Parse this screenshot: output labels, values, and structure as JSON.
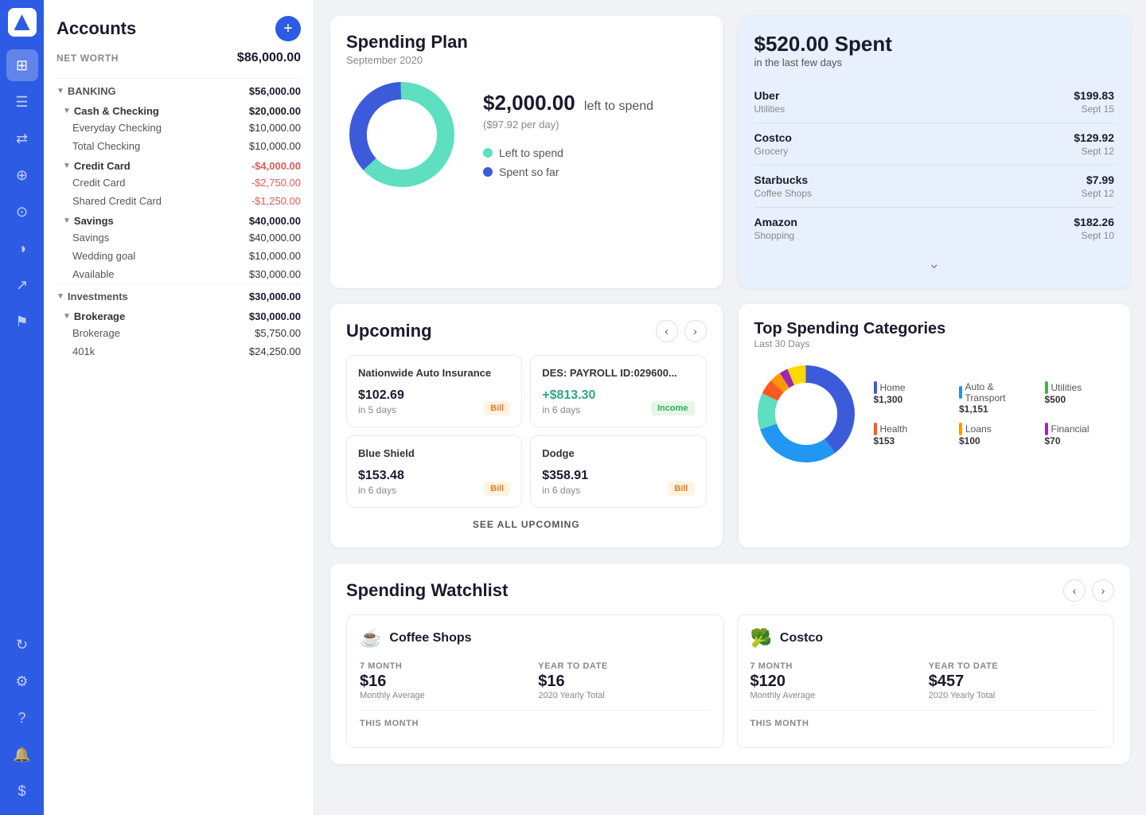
{
  "sidebar": {
    "nav_items": [
      {
        "id": "dashboard",
        "icon": "⊞",
        "active": true
      },
      {
        "id": "transactions",
        "icon": "≡"
      },
      {
        "id": "transfer",
        "icon": "⇄"
      },
      {
        "id": "upload",
        "icon": "⬆"
      },
      {
        "id": "search",
        "icon": "⊙"
      },
      {
        "id": "chart",
        "icon": "◑"
      },
      {
        "id": "trend",
        "icon": "↗"
      },
      {
        "id": "goal",
        "icon": "⚑"
      }
    ],
    "bottom_items": [
      {
        "id": "refresh",
        "icon": "↻"
      },
      {
        "id": "settings",
        "icon": "⚙"
      },
      {
        "id": "help",
        "icon": "?"
      },
      {
        "id": "notifications",
        "icon": "🔔"
      },
      {
        "id": "account",
        "icon": "$"
      }
    ]
  },
  "accounts": {
    "title": "Accounts",
    "add_button": "+",
    "net_worth_label": "NET WORTH",
    "net_worth_value": "$86,000.00",
    "sections": [
      {
        "id": "banking",
        "label": "BANKING",
        "value": "$56,000.00",
        "subsections": [
          {
            "id": "cash-checking",
            "label": "Cash & Checking",
            "value": "$20,000.00",
            "accounts": [
              {
                "name": "Everyday Checking",
                "value": "$10,000.00",
                "negative": false
              },
              {
                "name": "Total Checking",
                "value": "$10,000.00",
                "negative": false
              }
            ]
          },
          {
            "id": "credit-card",
            "label": "Credit Card",
            "value": "-$4,000.00",
            "accounts": [
              {
                "name": "Credit Card",
                "value": "-$2,750.00",
                "negative": true
              },
              {
                "name": "Shared Credit Card",
                "value": "-$1,250.00",
                "negative": true
              }
            ]
          },
          {
            "id": "savings",
            "label": "Savings",
            "value": "$40,000.00",
            "accounts": [
              {
                "name": "Savings",
                "value": "$40,000.00",
                "negative": false
              },
              {
                "name": "Wedding goal",
                "value": "$10,000.00",
                "negative": false
              },
              {
                "name": "Available",
                "value": "$30,000.00",
                "negative": false
              }
            ]
          }
        ]
      },
      {
        "id": "investments",
        "label": "Investments",
        "value": "$30,000.00",
        "subsections": [
          {
            "id": "brokerage",
            "label": "Brokerage",
            "value": "$30,000.00",
            "accounts": [
              {
                "name": "Brokerage",
                "value": "$5,750.00",
                "negative": false
              },
              {
                "name": "401k",
                "value": "$24,250.00",
                "negative": false
              }
            ]
          }
        ]
      }
    ]
  },
  "spending_plan": {
    "title": "Spending Plan",
    "subtitle": "September 2020",
    "amount": "$2,000.00",
    "label": "left to spend",
    "per_day": "($97.92 per day)",
    "legend": [
      {
        "label": "Left to spend",
        "color": "#5ddfc0"
      },
      {
        "label": "Spent so far",
        "color": "#3b5bdb"
      }
    ],
    "donut": {
      "left_pct": 65,
      "spent_pct": 35,
      "left_color": "#5ddfc0",
      "spent_color": "#3b5bdb"
    }
  },
  "recent_spending": {
    "title": "$520.00 Spent",
    "subtitle": "in the last few days",
    "transactions": [
      {
        "name": "Uber",
        "category": "Utilities",
        "amount": "$199.83",
        "date": "Sept 15"
      },
      {
        "name": "Costco",
        "category": "Grocery",
        "amount": "$129.92",
        "date": "Sept 12"
      },
      {
        "name": "Starbucks",
        "category": "Coffee Shops",
        "amount": "$7.99",
        "date": "Sept 12"
      },
      {
        "name": "Amazon",
        "category": "Shopping",
        "amount": "$182.26",
        "date": "Sept 10"
      }
    ]
  },
  "upcoming": {
    "title": "Upcoming",
    "items": [
      {
        "name": "Nationwide Auto Insurance",
        "amount": "$102.69",
        "days": "in 5 days",
        "badge": "Bill",
        "badge_type": "bill",
        "income": false
      },
      {
        "name": "DES: PAYROLL ID:029600...",
        "amount": "+$813.30",
        "days": "in 6 days",
        "badge": "Income",
        "badge_type": "income",
        "income": true
      },
      {
        "name": "Blue Shield",
        "amount": "$153.48",
        "days": "in 6 days",
        "badge": "Bill",
        "badge_type": "bill",
        "income": false
      },
      {
        "name": "Dodge",
        "amount": "$358.91",
        "days": "in 6 days",
        "badge": "Bill",
        "badge_type": "bill",
        "income": false
      }
    ],
    "see_all": "SEE ALL UPCOMING"
  },
  "top_spending": {
    "title": "Top Spending Categories",
    "subtitle": "Last 30 Days",
    "categories": [
      {
        "name": "Home",
        "value": "$1,300",
        "color": "#3b5bdb"
      },
      {
        "name": "Auto & Transport",
        "value": "$1,151",
        "color": "#2196F3"
      },
      {
        "name": "Utilities",
        "value": "$500",
        "color": "#4caf50"
      },
      {
        "name": "Health",
        "value": "$153",
        "color": "#ff5722"
      },
      {
        "name": "Loans",
        "value": "$100",
        "color": "#ff9800"
      },
      {
        "name": "Financial",
        "value": "$70",
        "color": "#9c27b0"
      }
    ],
    "donut_segments": [
      {
        "color": "#3b5bdb",
        "pct": 40
      },
      {
        "color": "#2196F3",
        "pct": 30
      },
      {
        "color": "#5ddfc0",
        "pct": 12
      },
      {
        "color": "#ff5722",
        "pct": 5
      },
      {
        "color": "#ff9800",
        "pct": 4
      },
      {
        "color": "#9c27b0",
        "pct": 3
      },
      {
        "color": "#ffd700",
        "pct": 6
      }
    ]
  },
  "watchlist": {
    "title": "Spending Watchlist",
    "items": [
      {
        "id": "coffee-shops",
        "icon": "☕",
        "name": "Coffee Shops",
        "month_label": "7 MONTH",
        "month_value": "$16",
        "month_desc": "Monthly Average",
        "ytd_label": "YEAR TO DATE",
        "ytd_value": "$16",
        "ytd_desc": "2020 Yearly Total",
        "this_month_label": "THIS MONTH"
      },
      {
        "id": "costco",
        "icon": "🥦",
        "name": "Costco",
        "month_label": "7 MONTH",
        "month_value": "$120",
        "month_desc": "Monthly Average",
        "ytd_label": "YEAR TO DATE",
        "ytd_value": "$457",
        "ytd_desc": "2020 Yearly Total",
        "this_month_label": "THIS MONTH"
      }
    ]
  }
}
